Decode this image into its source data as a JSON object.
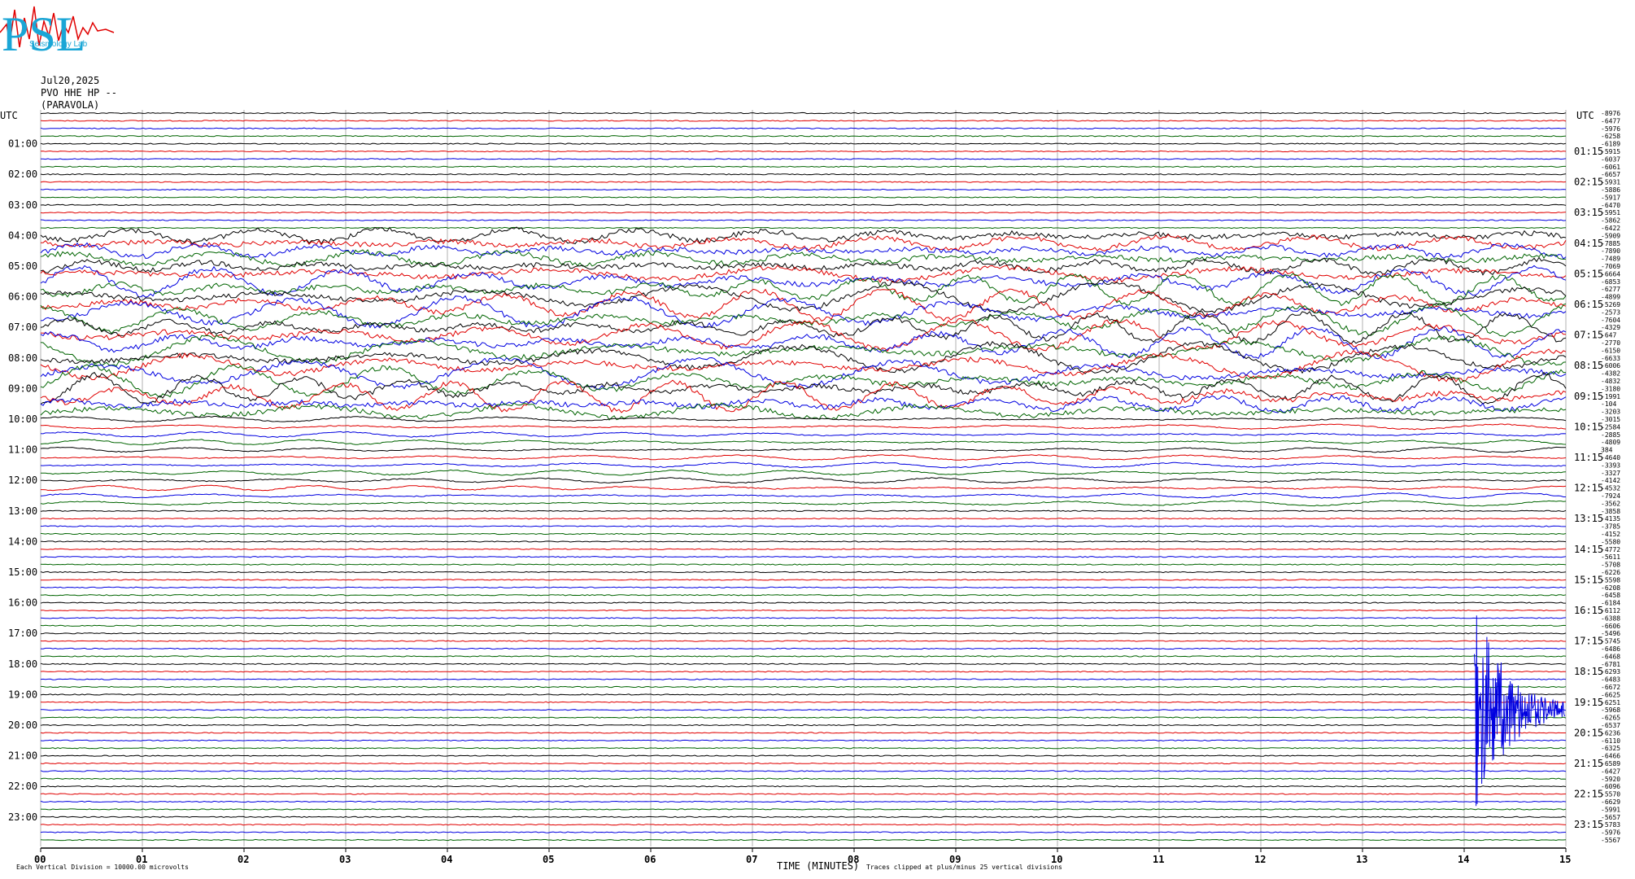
{
  "logo": {
    "text": "PSL",
    "subtitle": "Seismology Lab"
  },
  "header": {
    "date": "Jul20,2025",
    "station": "PVO HHE HP --",
    "name": "(PARAVOLA)"
  },
  "chart_data": {
    "type": "line",
    "left_tz": "UTC",
    "right_tz": "UTC",
    "left_hours": [
      "01:00",
      "02:00",
      "03:00",
      "04:00",
      "05:00",
      "06:00",
      "07:00",
      "08:00",
      "09:00",
      "10:00",
      "11:00",
      "12:00",
      "13:00",
      "14:00",
      "15:00",
      "16:00",
      "17:00",
      "18:00",
      "19:00",
      "20:00",
      "21:00",
      "22:00",
      "23:00"
    ],
    "right_hours": [
      "01:15",
      "02:15",
      "03:15",
      "04:15",
      "05:15",
      "06:15",
      "07:15",
      "08:15",
      "09:15",
      "10:15",
      "11:15",
      "12:15",
      "13:15",
      "14:15",
      "15:15",
      "16:15",
      "17:15",
      "18:15",
      "19:15",
      "20:15",
      "21:15",
      "22:15",
      "23:15"
    ],
    "x_ticks": [
      "00",
      "01",
      "02",
      "03",
      "04",
      "05",
      "06",
      "07",
      "08",
      "09",
      "10",
      "11",
      "12",
      "13",
      "14",
      "15"
    ],
    "xlabel": "TIME (MINUTES)",
    "scale_note": "Each Vertical Division = 10000.00 microvolts",
    "clip_note": "Traces clipped at plus/minus 25 vertical divisions",
    "xlim": [
      0,
      15
    ],
    "trace_colors": [
      "#000000",
      "#e00000",
      "#0000e0",
      "#006400"
    ],
    "offsets": [
      "-8976",
      "-6477",
      "-5976",
      "-6258",
      "-6189",
      "-5915",
      "-6037",
      "-6061",
      "-6657",
      "-5931",
      "-5886",
      "-5917",
      "-6470",
      "-5951",
      "-5862",
      "-6422",
      "-5909",
      "-7885",
      "-7890",
      "-7489",
      "-7069",
      "-6664",
      "-6853",
      "-6277",
      "-4899",
      "-5269",
      "-2573",
      "-7604",
      "-4329",
      "-647",
      "-2770",
      "-6150",
      "-6633",
      "-6006",
      "-4382",
      "-4832",
      "-3180",
      "-1991",
      "-104",
      "-3203",
      "-3015",
      "-2584",
      "-2885",
      "-4809",
      "384",
      "-4640",
      "-3393",
      "-3327",
      "-4142",
      "-4532",
      "-7924",
      "-3562",
      "-3858",
      "-4135",
      "-3785",
      "-4152",
      "-5580",
      "-4772",
      "-5611",
      "-5708",
      "-6226",
      "-5598",
      "-6208",
      "-6458",
      "-6184",
      "-6112",
      "-6388",
      "-6606",
      "-5496",
      "-5745",
      "-6486",
      "-6468",
      "-6781",
      "-6293",
      "-6483",
      "-6672",
      "-6625",
      "-6251",
      "-5968",
      "-6265",
      "-6537",
      "-6236",
      "-6110",
      "-6325",
      "-6466",
      "-6589",
      "-6427",
      "-5920",
      "-6096",
      "-5570",
      "-6629",
      "-5991",
      "-5657",
      "-5783",
      "-5976",
      "-5567"
    ]
  }
}
